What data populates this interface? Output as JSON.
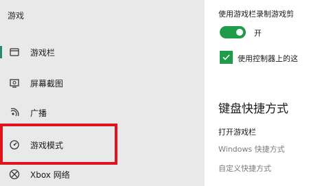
{
  "sidebar": {
    "section_title": "游戏",
    "items": [
      {
        "label": "游戏栏",
        "icon": "game-bar-icon",
        "active": true
      },
      {
        "label": "屏幕截图",
        "icon": "screenshot-icon",
        "active": false
      },
      {
        "label": "广播",
        "icon": "broadcast-icon",
        "active": false
      },
      {
        "label": "游戏模式",
        "icon": "game-mode-icon",
        "active": false
      },
      {
        "label": "Xbox 网络",
        "icon": "xbox-icon",
        "active": false
      }
    ]
  },
  "content": {
    "record_setting_label": "使用游戏栏录制游戏剪",
    "toggle": {
      "state_label": "开",
      "on": true
    },
    "controller_checkbox": {
      "label": "使用控制器上的这",
      "checked": true
    },
    "shortcuts_heading": "键盘快捷方式",
    "open_game_bar_label": "打开游戏栏",
    "windows_shortcut_label": "Windows 快捷方式",
    "custom_shortcut_label": "自定义快捷方式"
  },
  "colors": {
    "accent_green": "#1f9c4a",
    "highlight_red": "#e0141c",
    "sidebar_bg": "#e9e9e9"
  }
}
